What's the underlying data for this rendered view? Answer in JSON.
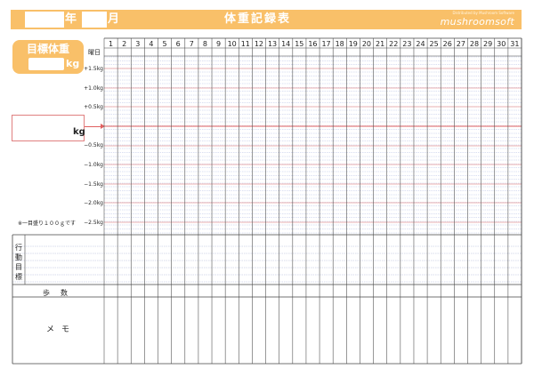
{
  "header": {
    "year_label": "年",
    "month_label": "月",
    "title": "体重記録表",
    "brand_sub": "Distributed by Mushroom Software",
    "brand": "mushroomsoft"
  },
  "target": {
    "label": "目標体重",
    "unit": "kg"
  },
  "current": {
    "unit": "kg"
  },
  "weekday_label": "曜日",
  "y_labels": [
    "+1.5kg",
    "+1.0kg",
    "+0.5kg",
    "−0.5kg",
    "−1.0kg",
    "−1.5kg",
    "−2.0kg",
    "−2.5kg"
  ],
  "note": "※一目盛り１００ｇです",
  "action_label": "行動目標",
  "steps_label": "歩数",
  "memo_label": "メモ",
  "days": [
    "1",
    "2",
    "3",
    "4",
    "5",
    "6",
    "7",
    "8",
    "9",
    "10",
    "11",
    "12",
    "13",
    "14",
    "15",
    "16",
    "17",
    "18",
    "19",
    "20",
    "21",
    "22",
    "23",
    "24",
    "25",
    "26",
    "27",
    "28",
    "29",
    "30",
    "31"
  ],
  "colors": {
    "header_orange": "#f9c069",
    "red_line": "#e06060",
    "blue_line": "#7a8fd0"
  }
}
